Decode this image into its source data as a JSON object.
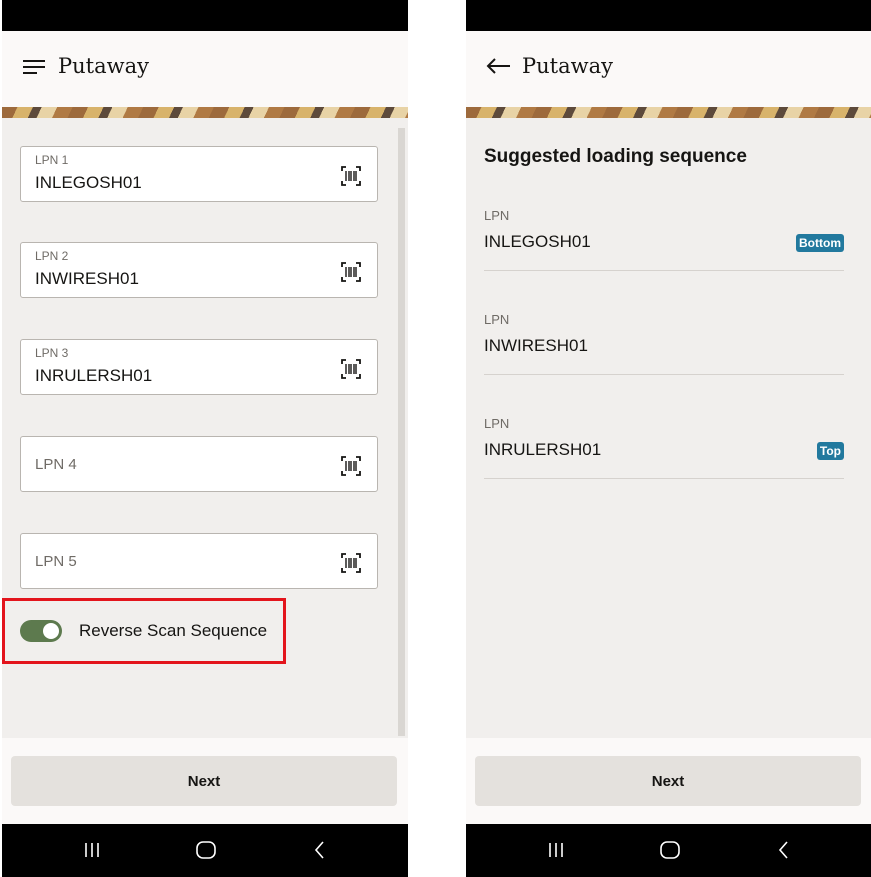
{
  "left_screen": {
    "title": "Putaway",
    "fields": [
      {
        "label": "LPN 1",
        "value": "INLEGOSH01"
      },
      {
        "label": "LPN 2",
        "value": "INWIRESH01"
      },
      {
        "label": "LPN 3",
        "value": "INRULERSH01"
      },
      {
        "label": "LPN 4",
        "value": ""
      },
      {
        "label": "LPN 5",
        "value": ""
      }
    ],
    "toggle": {
      "label": "Reverse Scan Sequence",
      "on": true,
      "color": "#5d7a4e"
    },
    "next_label": "Next"
  },
  "right_screen": {
    "title": "Putaway",
    "section_title": "Suggested loading sequence",
    "items": [
      {
        "key": "LPN",
        "value": "INLEGOSH01",
        "badge": "Bottom"
      },
      {
        "key": "LPN",
        "value": "INWIRESH01",
        "badge": ""
      },
      {
        "key": "LPN",
        "value": "INRULERSH01",
        "badge": "Top"
      }
    ],
    "badge_color": "#22799e",
    "next_label": "Next"
  },
  "icons": {
    "menu": "hamburger-menu-icon",
    "back": "back-arrow-icon",
    "scan": "barcode-scan-icon",
    "recents": "recent-apps-icon",
    "home": "home-icon",
    "back_system": "chevron-left-icon"
  },
  "highlight_color": "#e3141c"
}
